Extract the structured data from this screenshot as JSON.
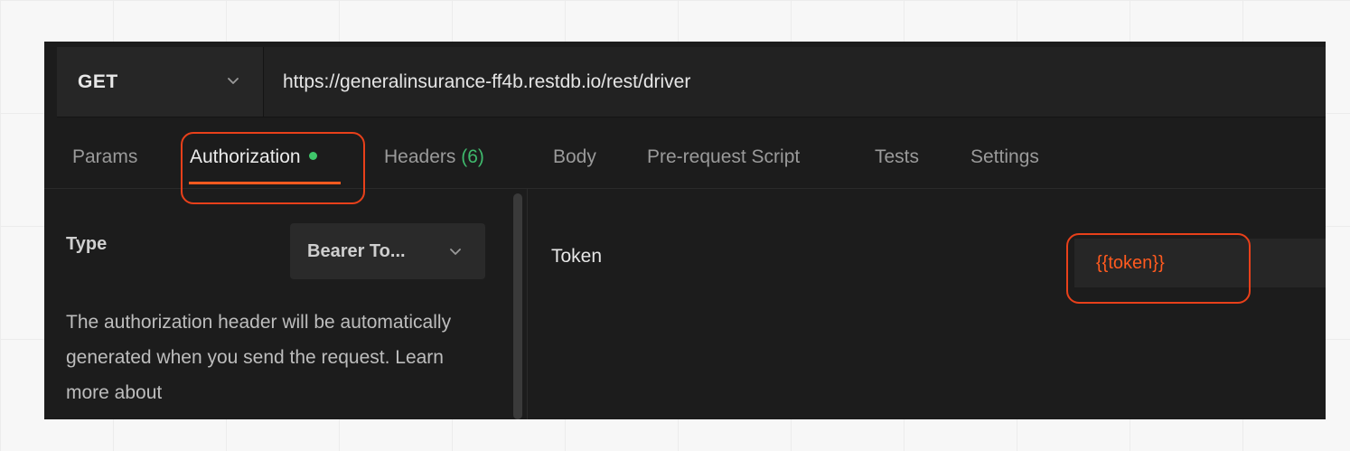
{
  "request": {
    "method": "GET",
    "url": "https://generalinsurance-ff4b.restdb.io/rest/driver"
  },
  "tabs": {
    "params": "Params",
    "authorization": "Authorization",
    "headers": "Headers",
    "headers_count": "(6)",
    "body": "Body",
    "pre_request": "Pre-request Script",
    "tests": "Tests",
    "settings": "Settings"
  },
  "auth": {
    "type_label": "Type",
    "type_value": "Bearer To...",
    "description": "The authorization header will be automatically generated when you send the request. Learn more about",
    "token_label": "Token",
    "token_value": "{{token}}"
  },
  "colors": {
    "accent": "#ff5a1f",
    "annotation": "#e8401a",
    "success": "#3fc66a",
    "panel_bg": "#1c1c1c"
  }
}
